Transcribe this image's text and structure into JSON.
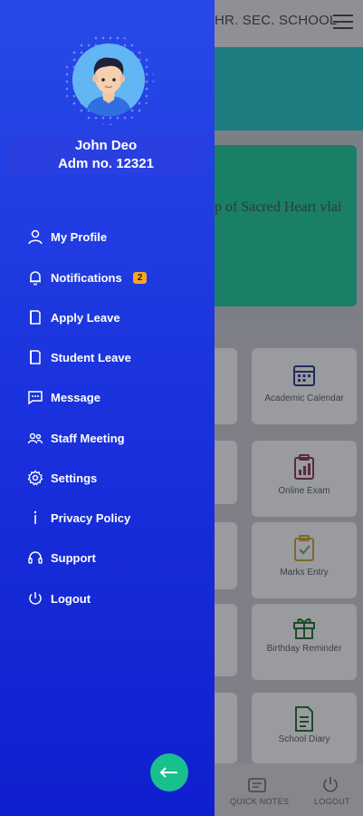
{
  "background": {
    "school_title": "HR. SEC. SCHOOL",
    "card_text": "p of Sacred Heart vlai",
    "tiles": [
      {
        "label": "Academic Calendar",
        "icon": "calendar-icon"
      },
      {
        "label": "Online Exam",
        "icon": "exam-clipboard-icon"
      },
      {
        "label": "Marks Entry",
        "icon": "marks-entry-icon"
      },
      {
        "label": "Birthday Reminder",
        "icon": "gift-icon"
      },
      {
        "label": "School Diary",
        "icon": "diary-icon"
      }
    ],
    "bottom_nav": [
      {
        "label": "QUICK NOTES",
        "icon": "notes-icon"
      },
      {
        "label": "LOGOUT",
        "icon": "power-icon"
      }
    ]
  },
  "drawer": {
    "user_name": "John Deo",
    "admission": "Adm no. 12321",
    "menu": [
      {
        "label": "My Profile",
        "icon": "user-icon"
      },
      {
        "label": "Notifications",
        "icon": "bell-icon",
        "badge": "2"
      },
      {
        "label": "Apply Leave",
        "icon": "document-icon"
      },
      {
        "label": "Student Leave",
        "icon": "document-icon"
      },
      {
        "label": "Message",
        "icon": "message-icon"
      },
      {
        "label": "Staff Meeting",
        "icon": "group-icon"
      },
      {
        "label": "Settings",
        "icon": "gear-icon"
      },
      {
        "label": "Privacy Policy",
        "icon": "info-icon"
      },
      {
        "label": "Support",
        "icon": "headset-icon"
      },
      {
        "label": "Logout",
        "icon": "power-icon"
      }
    ],
    "back_icon": "arrow-left-icon"
  },
  "colors": {
    "drawer_top": "#2849e8",
    "drawer_bottom": "#0f1fcf",
    "badge": "#f5a623",
    "back_button": "#18c08e"
  }
}
